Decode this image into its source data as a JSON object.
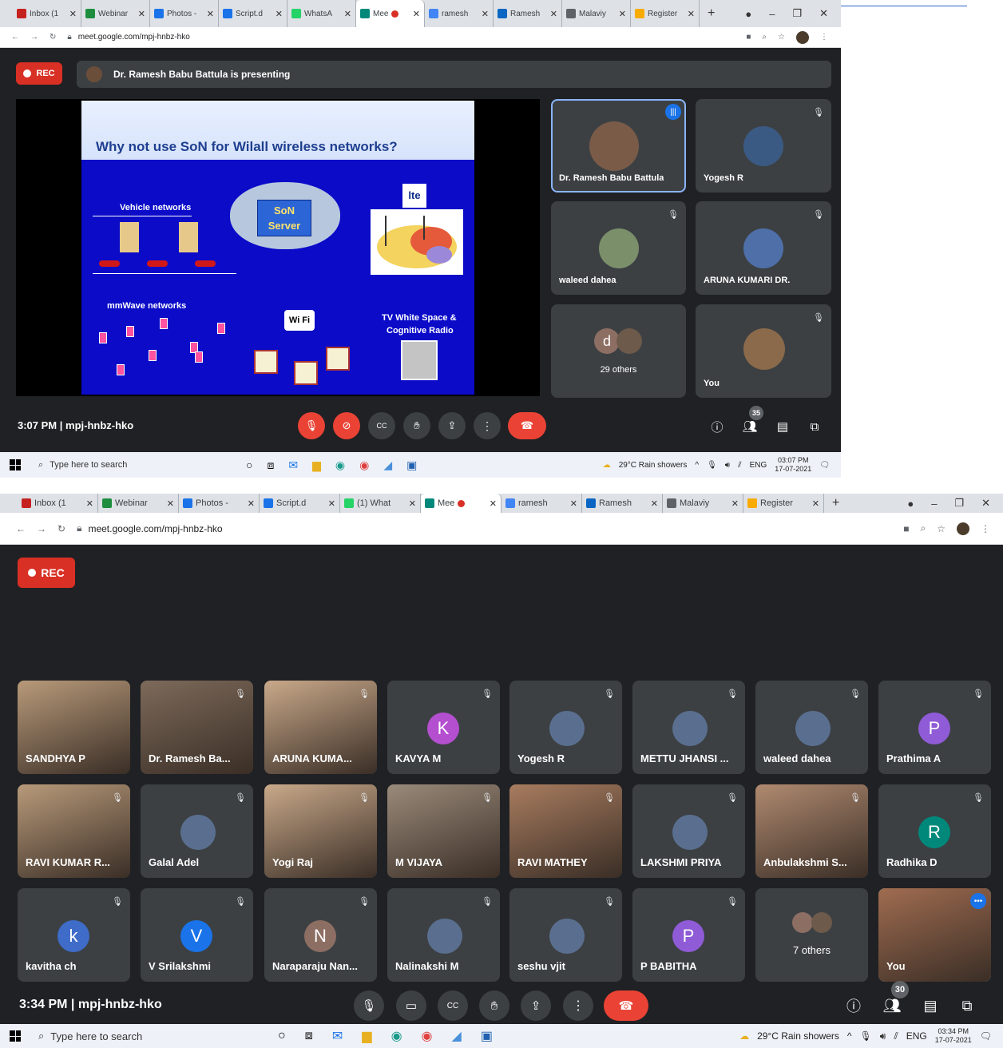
{
  "screenshot1": {
    "tabs": [
      {
        "label": "Inbox (1",
        "icon": "gmail-icon",
        "color": "#c5221f"
      },
      {
        "label": "Webinar",
        "icon": "drive-icon",
        "color": "#1e8e3e"
      },
      {
        "label": "Photos -",
        "icon": "docs-icon",
        "color": "#1a73e8"
      },
      {
        "label": "Script.d",
        "icon": "docs-icon",
        "color": "#1a73e8"
      },
      {
        "label": "WhatsA",
        "icon": "whatsapp-icon",
        "color": "#25d366"
      },
      {
        "label": "Mee",
        "icon": "meet-icon",
        "color": "#00897b"
      },
      {
        "label": "ramesh",
        "icon": "google-icon",
        "color": "#4285f4"
      },
      {
        "label": "Ramesh",
        "icon": "linkedin-icon",
        "color": "#0a66c2"
      },
      {
        "label": "Malaviy",
        "icon": "site-icon",
        "color": "#5f6368"
      },
      {
        "label": "Register",
        "icon": "forms-icon",
        "color": "#f9ab00"
      }
    ],
    "url": "meet.google.com/mpj-hnbz-hko",
    "rec_label": "REC",
    "presenting_text": "Dr. Ramesh Babu Battula is presenting",
    "slide": {
      "title": "Why not use SoN for Wilall wireless networks?",
      "labels": {
        "vehicle": "Vehicle networks",
        "son": "SoN",
        "server": "Server",
        "lte": "lte",
        "mmwave": "mmWave networks",
        "wifi": "Wi Fi",
        "tv1": "TV White Space &",
        "tv2": "Cognitive Radio"
      }
    },
    "tiles": [
      {
        "name": "Dr. Ramesh Babu Battula"
      },
      {
        "name": "Yogesh R"
      },
      {
        "name": "waleed dahea"
      },
      {
        "name": "ARUNA KUMARI DR."
      },
      {
        "name": "29 others",
        "initial": "d"
      },
      {
        "name": "You"
      }
    ],
    "time": "3:07 PM",
    "meeting_code": "mpj-hnbz-hko",
    "participant_count": "35",
    "taskbar": {
      "search": "Type here to search",
      "weather": "29°C  Rain showers",
      "lang": "ENG",
      "clock_time": "03:07 PM",
      "clock_date": "17-07-2021"
    }
  },
  "screenshot2": {
    "tabs": [
      {
        "label": "Inbox (1",
        "icon": "gmail-icon",
        "color": "#c5221f"
      },
      {
        "label": "Webinar",
        "icon": "drive-icon",
        "color": "#1e8e3e"
      },
      {
        "label": "Photos -",
        "icon": "docs-icon",
        "color": "#1a73e8"
      },
      {
        "label": "Script.d",
        "icon": "docs-icon",
        "color": "#1a73e8"
      },
      {
        "label": "(1) What",
        "icon": "whatsapp-icon",
        "color": "#25d366"
      },
      {
        "label": "Mee",
        "icon": "meet-icon",
        "color": "#00897b"
      },
      {
        "label": "ramesh",
        "icon": "google-icon",
        "color": "#4285f4"
      },
      {
        "label": "Ramesh",
        "icon": "linkedin-icon",
        "color": "#0a66c2"
      },
      {
        "label": "Malaviy",
        "icon": "site-icon",
        "color": "#5f6368"
      },
      {
        "label": "Register",
        "icon": "forms-icon",
        "color": "#f9ab00"
      }
    ],
    "url": "meet.google.com/mpj-hnbz-hko",
    "rec_label": "REC",
    "tiles": [
      {
        "name": "SANDHYA P",
        "video": true
      },
      {
        "name": "Dr. Ramesh Ba...",
        "video": true
      },
      {
        "name": "ARUNA KUMA...",
        "video": true
      },
      {
        "name": "KAVYA M",
        "initial": "K",
        "color": "#b44fcf"
      },
      {
        "name": "Yogesh R"
      },
      {
        "name": "METTU JHANSI ..."
      },
      {
        "name": "waleed dahea"
      },
      {
        "name": "Prathima A",
        "initial": "P",
        "color": "#8f5bd6"
      },
      {
        "name": "RAVI KUMAR R...",
        "video": true
      },
      {
        "name": "Galal Adel"
      },
      {
        "name": "Yogi Raj",
        "video": true
      },
      {
        "name": "M VIJAYA",
        "video": true
      },
      {
        "name": "RAVI MATHEY",
        "video": true
      },
      {
        "name": "LAKSHMI PRIYA"
      },
      {
        "name": "Anbulakshmi S...",
        "video": true
      },
      {
        "name": "Radhika D",
        "initial": "R",
        "color": "#00897b"
      },
      {
        "name": "kavitha ch",
        "initial": "k",
        "color": "#3f6cc9"
      },
      {
        "name": "V Srilakshmi",
        "initial": "V",
        "color": "#1a73e8"
      },
      {
        "name": "Naraparaju Nan...",
        "initial": "N",
        "color": "#8d6e63"
      },
      {
        "name": "Nalinakshi M"
      },
      {
        "name": "seshu vjit"
      },
      {
        "name": "P BABITHA",
        "initial": "P",
        "color": "#8f5bd6"
      },
      {
        "name": "7 others"
      },
      {
        "name": "You",
        "video": true
      }
    ],
    "time": "3:34 PM",
    "meeting_code": "mpj-hnbz-hko",
    "participant_count": "30",
    "taskbar": {
      "search": "Type here to search",
      "weather": "29°C  Rain showers",
      "lang": "ENG",
      "clock_time": "03:34 PM",
      "clock_date": "17-07-2021"
    }
  }
}
